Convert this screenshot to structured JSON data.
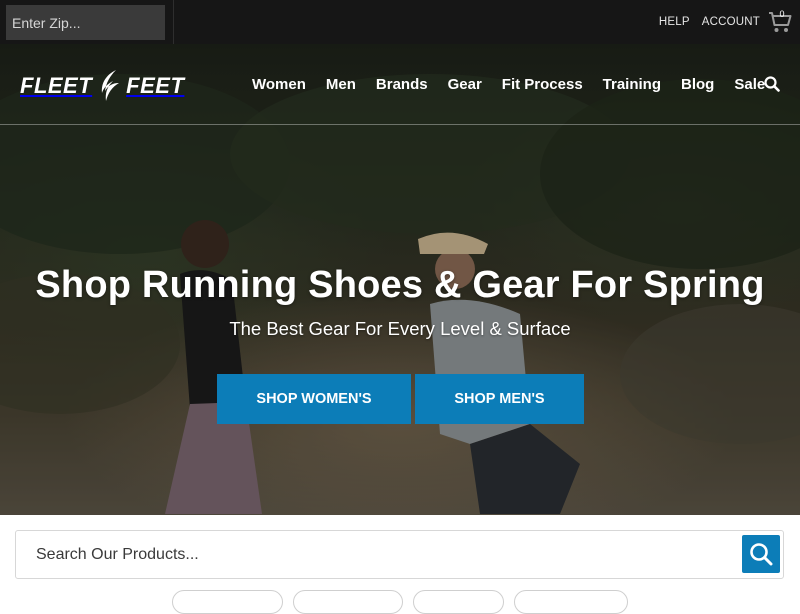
{
  "topbar": {
    "zip_placeholder": "Enter Zip...",
    "help_label": "HELP",
    "account_label": "ACCOUNT",
    "cart_count": "0"
  },
  "nav": {
    "logo_left": "FLEET",
    "logo_right": "FEET",
    "items": [
      "Women",
      "Men",
      "Brands",
      "Gear",
      "Fit Process",
      "Training",
      "Blog",
      "Sale"
    ]
  },
  "hero": {
    "title": "Shop Running Shoes & Gear For Spring",
    "subtitle": "The Best Gear For Every Level & Surface",
    "cta_women": "SHOP WOMEN'S",
    "cta_men": "SHOP MEN'S"
  },
  "search": {
    "placeholder": "Search Our Products..."
  },
  "colors": {
    "accent": "#0c7db8",
    "topbar_bg": "#161616"
  },
  "icons": {
    "cart": "cart-icon",
    "search": "search-icon",
    "logo": "logo-wing-icon"
  }
}
